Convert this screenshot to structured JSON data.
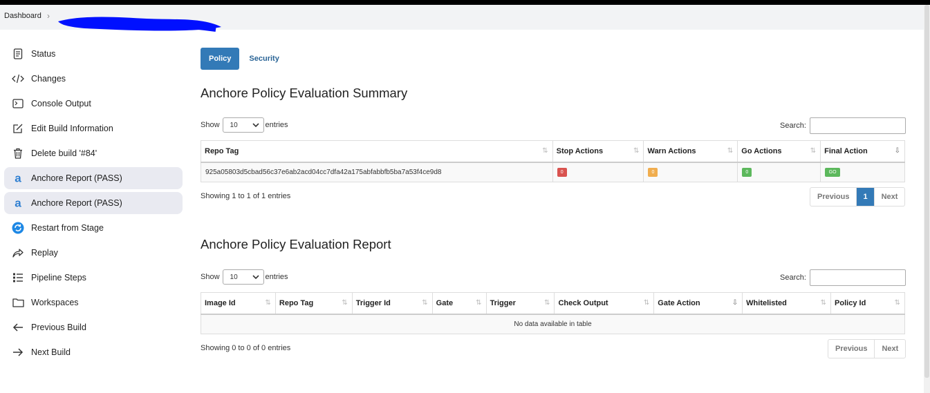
{
  "breadcrumb": {
    "dashboard": "Dashboard",
    "separator": "›"
  },
  "sidebar": {
    "items": [
      {
        "label": "Status",
        "icon": "status-icon"
      },
      {
        "label": "Changes",
        "icon": "code-icon"
      },
      {
        "label": "Console Output",
        "icon": "terminal-icon"
      },
      {
        "label": "Edit Build Information",
        "icon": "edit-icon"
      },
      {
        "label": "Delete build '#84'",
        "icon": "trash-icon"
      },
      {
        "label": "Anchore Report (PASS)",
        "icon": "anchore-icon"
      },
      {
        "label": "Anchore Report (PASS)",
        "icon": "anchore-icon"
      },
      {
        "label": "Restart from Stage",
        "icon": "restart-icon"
      },
      {
        "label": "Replay",
        "icon": "replay-icon"
      },
      {
        "label": "Pipeline Steps",
        "icon": "list-icon"
      },
      {
        "label": "Workspaces",
        "icon": "folder-icon"
      },
      {
        "label": "Previous Build",
        "icon": "arrow-left-icon"
      },
      {
        "label": "Next Build",
        "icon": "arrow-right-icon"
      }
    ]
  },
  "tabs": {
    "policy": "Policy",
    "security": "Security"
  },
  "summary": {
    "title": "Anchore Policy Evaluation Summary",
    "show": "Show",
    "entries_value": "10",
    "entries": "entries",
    "search": "Search:",
    "columns": [
      "Repo Tag",
      "Stop Actions",
      "Warn Actions",
      "Go Actions",
      "Final Action"
    ],
    "row": {
      "repo_tag": "925a05803d5cbad56c37e6ab2acd04cc7dfa42a175abfabbfb5ba7a53f4ce9d8",
      "stop": "0",
      "warn": "0",
      "go": "0",
      "final": "GO"
    },
    "info": "Showing 1 to 1 of 1 entries",
    "pager": {
      "previous": "Previous",
      "page": "1",
      "next": "Next"
    }
  },
  "report": {
    "title": "Anchore Policy Evaluation Report",
    "show": "Show",
    "entries_value": "10",
    "entries": "entries",
    "search": "Search:",
    "columns": [
      "Image Id",
      "Repo Tag",
      "Trigger Id",
      "Gate",
      "Trigger",
      "Check Output",
      "Gate Action",
      "Whitelisted",
      "Policy Id"
    ],
    "empty": "No data available in table",
    "info": "Showing 0 to 0 of 0 entries",
    "pager": {
      "previous": "Previous",
      "next": "Next"
    }
  },
  "colors": {
    "accent": "#337ab7",
    "stop": "#d9534f",
    "warn": "#f0ad4e",
    "go": "#5cb85c"
  }
}
